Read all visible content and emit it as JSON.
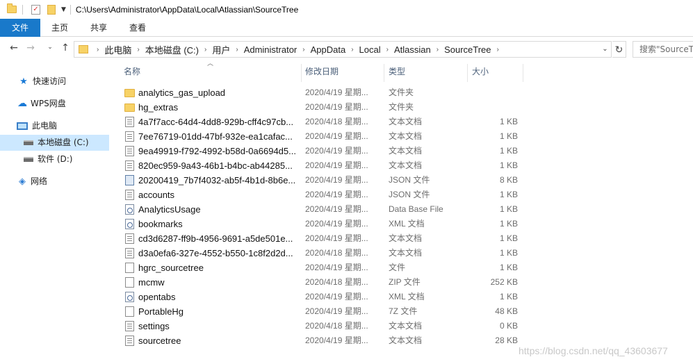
{
  "window": {
    "title_path": "C:\\Users\\Administrator\\AppData\\Local\\Atlassian\\SourceTree"
  },
  "ribbon": {
    "tabs": [
      "文件",
      "主页",
      "共享",
      "查看"
    ]
  },
  "address": {
    "breadcrumbs": [
      "此电脑",
      "本地磁盘 (C:)",
      "用户",
      "Administrator",
      "AppData",
      "Local",
      "Atlassian",
      "SourceTree"
    ],
    "search_placeholder": "搜索\"SourceTree\""
  },
  "nav": {
    "quick_access": "快速访问",
    "wps": "WPS网盘",
    "this_pc": "此电脑",
    "drive_c": "本地磁盘 (C:)",
    "drive_d": "软件 (D:)",
    "network": "网络"
  },
  "columns": {
    "name": "名称",
    "date": "修改日期",
    "type": "类型",
    "size": "大小"
  },
  "files": [
    {
      "icon": "folder-icon",
      "name": "analytics_gas_upload",
      "date": "2020/4/19 星期...",
      "type": "文件夹",
      "size": ""
    },
    {
      "icon": "folder-icon",
      "name": "hg_extras",
      "date": "2020/4/19 星期...",
      "type": "文件夹",
      "size": ""
    },
    {
      "icon": "text-file-icon",
      "name": "4a7f7acc-64d4-4dd8-929b-cff4c97cb...",
      "date": "2020/4/18 星期...",
      "type": "文本文档",
      "size": "1 KB"
    },
    {
      "icon": "text-file-icon",
      "name": "7ee76719-01dd-47bf-932e-ea1cafac...",
      "date": "2020/4/19 星期...",
      "type": "文本文档",
      "size": "1 KB"
    },
    {
      "icon": "text-file-icon",
      "name": "9ea49919-f792-4992-b58d-0a6694d5...",
      "date": "2020/4/19 星期...",
      "type": "文本文档",
      "size": "1 KB"
    },
    {
      "icon": "text-file-icon",
      "name": "820ec959-9a43-46b1-b4bc-ab44285...",
      "date": "2020/4/19 星期...",
      "type": "文本文档",
      "size": "1 KB"
    },
    {
      "icon": "json-file-icon",
      "name": "20200419_7b7f4032-ab5f-4b1d-8b6e...",
      "date": "2020/4/19 星期...",
      "type": "JSON 文件",
      "size": "8 KB"
    },
    {
      "icon": "text-file-icon",
      "name": "accounts",
      "date": "2020/4/19 星期...",
      "type": "JSON 文件",
      "size": "1 KB"
    },
    {
      "icon": "gear-file-icon",
      "name": "AnalyticsUsage",
      "date": "2020/4/19 星期...",
      "type": "Data Base File",
      "size": "1 KB"
    },
    {
      "icon": "gear-file-icon",
      "name": "bookmarks",
      "date": "2020/4/19 星期...",
      "type": "XML 文档",
      "size": "1 KB"
    },
    {
      "icon": "text-file-icon",
      "name": "cd3d6287-ff9b-4956-9691-a5de501e...",
      "date": "2020/4/19 星期...",
      "type": "文本文档",
      "size": "1 KB"
    },
    {
      "icon": "text-file-icon",
      "name": "d3a0efa6-327e-4552-b550-1c8f2d2d...",
      "date": "2020/4/18 星期...",
      "type": "文本文档",
      "size": "1 KB"
    },
    {
      "icon": "blank-file-icon",
      "name": "hgrc_sourcetree",
      "date": "2020/4/19 星期...",
      "type": "文件",
      "size": "1 KB"
    },
    {
      "icon": "blank-file-icon",
      "name": "mcmw",
      "date": "2020/4/18 星期...",
      "type": "ZIP 文件",
      "size": "252 KB"
    },
    {
      "icon": "gear-file-icon",
      "name": "opentabs",
      "date": "2020/4/19 星期...",
      "type": "XML 文档",
      "size": "1 KB"
    },
    {
      "icon": "blank-file-icon",
      "name": "PortableHg",
      "date": "2020/4/19 星期...",
      "type": "7Z 文件",
      "size": "48 KB"
    },
    {
      "icon": "text-file-icon",
      "name": "settings",
      "date": "2020/4/18 星期...",
      "type": "文本文档",
      "size": "0 KB"
    },
    {
      "icon": "text-file-icon",
      "name": "sourcetree",
      "date": "2020/4/19 星期...",
      "type": "文本文档",
      "size": "28 KB"
    }
  ],
  "watermark": "https://blog.csdn.net/qq_43603677"
}
